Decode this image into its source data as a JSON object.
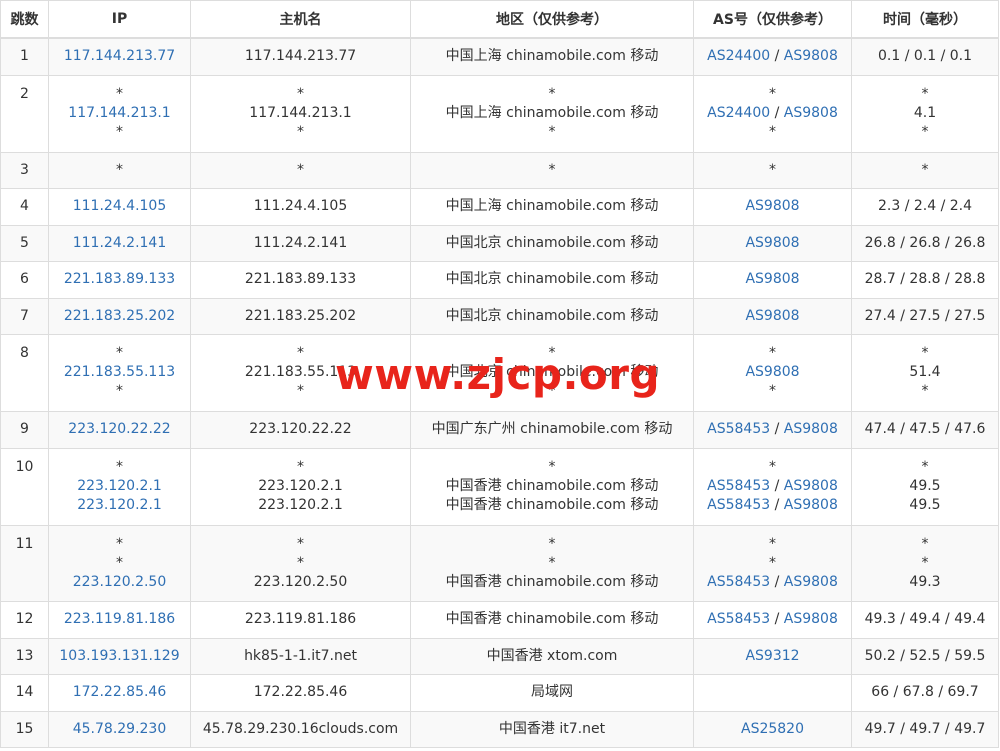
{
  "headers": [
    "跳数",
    "IP",
    "主机名",
    "地区（仅供参考）",
    "AS号（仅供参考）",
    "时间（毫秒）"
  ],
  "watermark": "www.zjcp.org",
  "rows": [
    {
      "hop": "1",
      "ip": [
        "117.144.213.77"
      ],
      "host": [
        "117.144.213.77"
      ],
      "region": [
        "中国上海 chinamobile.com 移动"
      ],
      "as": [
        [
          "AS24400",
          "AS9808"
        ]
      ],
      "time": [
        "0.1 / 0.1 / 0.1"
      ],
      "h": 37
    },
    {
      "hop": "2",
      "ip": [
        "*",
        "117.144.213.1",
        "*"
      ],
      "host": [
        "*",
        "117.144.213.1",
        "*"
      ],
      "region": [
        "*",
        "中国上海 chinamobile.com 移动",
        "*"
      ],
      "as": [
        [
          "*"
        ],
        [
          "AS24400",
          "AS9808"
        ],
        [
          "*"
        ]
      ],
      "time": [
        "*",
        "4.1",
        "*"
      ],
      "h": 77
    },
    {
      "hop": "3",
      "ip": [
        "*"
      ],
      "host": [
        "*"
      ],
      "region": [
        "*"
      ],
      "as": [
        [
          "*"
        ]
      ],
      "time": [
        "*"
      ],
      "h": 36
    },
    {
      "hop": "4",
      "ip": [
        "111.24.4.105"
      ],
      "host": [
        "111.24.4.105"
      ],
      "region": [
        "中国上海 chinamobile.com 移动"
      ],
      "as": [
        [
          "AS9808"
        ]
      ],
      "time": [
        "2.3 / 2.4 / 2.4"
      ],
      "h": 37
    },
    {
      "hop": "5",
      "ip": [
        "111.24.2.141"
      ],
      "host": [
        "111.24.2.141"
      ],
      "region": [
        "中国北京 chinamobile.com 移动"
      ],
      "as": [
        [
          "AS9808"
        ]
      ],
      "time": [
        "26.8 / 26.8 / 26.8"
      ],
      "h": 36
    },
    {
      "hop": "6",
      "ip": [
        "221.183.89.133"
      ],
      "host": [
        "221.183.89.133"
      ],
      "region": [
        "中国北京 chinamobile.com 移动"
      ],
      "as": [
        [
          "AS9808"
        ]
      ],
      "time": [
        "28.7 / 28.8 / 28.8"
      ],
      "h": 37
    },
    {
      "hop": "7",
      "ip": [
        "221.183.25.202"
      ],
      "host": [
        "221.183.25.202"
      ],
      "region": [
        "中国北京 chinamobile.com 移动"
      ],
      "as": [
        [
          "AS9808"
        ]
      ],
      "time": [
        "27.4 / 27.5 / 27.5"
      ],
      "h": 36
    },
    {
      "hop": "8",
      "ip": [
        "*",
        "221.183.55.113",
        "*"
      ],
      "host": [
        "*",
        "221.183.55.113",
        "*"
      ],
      "region": [
        "*",
        "中国北京 chinamobile.com 移动",
        "*"
      ],
      "as": [
        [
          "*"
        ],
        [
          "AS9808"
        ],
        [
          "*"
        ]
      ],
      "time": [
        "*",
        "51.4",
        "*"
      ],
      "h": 77
    },
    {
      "hop": "9",
      "ip": [
        "223.120.22.22"
      ],
      "host": [
        "223.120.22.22"
      ],
      "region": [
        "中国广东广州 chinamobile.com 移动"
      ],
      "as": [
        [
          "AS58453",
          "AS9808"
        ]
      ],
      "time": [
        "47.4 / 47.5 / 47.6"
      ],
      "h": 37
    },
    {
      "hop": "10",
      "ip": [
        "*",
        "223.120.2.1",
        "223.120.2.1"
      ],
      "host": [
        "*",
        "223.120.2.1",
        "223.120.2.1"
      ],
      "region": [
        "*",
        "中国香港 chinamobile.com 移动",
        "中国香港 chinamobile.com 移动"
      ],
      "as": [
        [
          "*"
        ],
        [
          "AS58453",
          "AS9808"
        ],
        [
          "AS58453",
          "AS9808"
        ]
      ],
      "time": [
        "*",
        "49.5",
        "49.5"
      ],
      "h": 77
    },
    {
      "hop": "11",
      "ip": [
        "*",
        "*",
        "223.120.2.50"
      ],
      "host": [
        "*",
        "*",
        "223.120.2.50"
      ],
      "region": [
        "*",
        "*",
        "中国香港 chinamobile.com 移动"
      ],
      "as": [
        [
          "*"
        ],
        [
          "*"
        ],
        [
          "AS58453",
          "AS9808"
        ]
      ],
      "time": [
        "*",
        "*",
        "49.3"
      ],
      "h": 76
    },
    {
      "hop": "12",
      "ip": [
        "223.119.81.186"
      ],
      "host": [
        "223.119.81.186"
      ],
      "region": [
        "中国香港 chinamobile.com 移动"
      ],
      "as": [
        [
          "AS58453",
          "AS9808"
        ]
      ],
      "time": [
        "49.3 / 49.4 / 49.4"
      ],
      "h": 37
    },
    {
      "hop": "13",
      "ip": [
        "103.193.131.129"
      ],
      "host": [
        "hk85-1-1.it7.net"
      ],
      "region": [
        "中国香港 xtom.com"
      ],
      "as": [
        [
          "AS9312"
        ]
      ],
      "time": [
        "50.2 / 52.5 / 59.5"
      ],
      "h": 36
    },
    {
      "hop": "14",
      "ip": [
        "172.22.85.46"
      ],
      "host": [
        "172.22.85.46"
      ],
      "region": [
        "局域网"
      ],
      "as": [
        []
      ],
      "time": [
        "66 / 67.8 / 69.7"
      ],
      "h": 37
    },
    {
      "hop": "15",
      "ip": [
        "45.78.29.230"
      ],
      "host": [
        "45.78.29.230.16clouds.com"
      ],
      "region": [
        "中国香港 it7.net"
      ],
      "as": [
        [
          "AS25820"
        ]
      ],
      "time": [
        "49.7 / 49.7 / 49.7"
      ],
      "h": 36
    }
  ]
}
